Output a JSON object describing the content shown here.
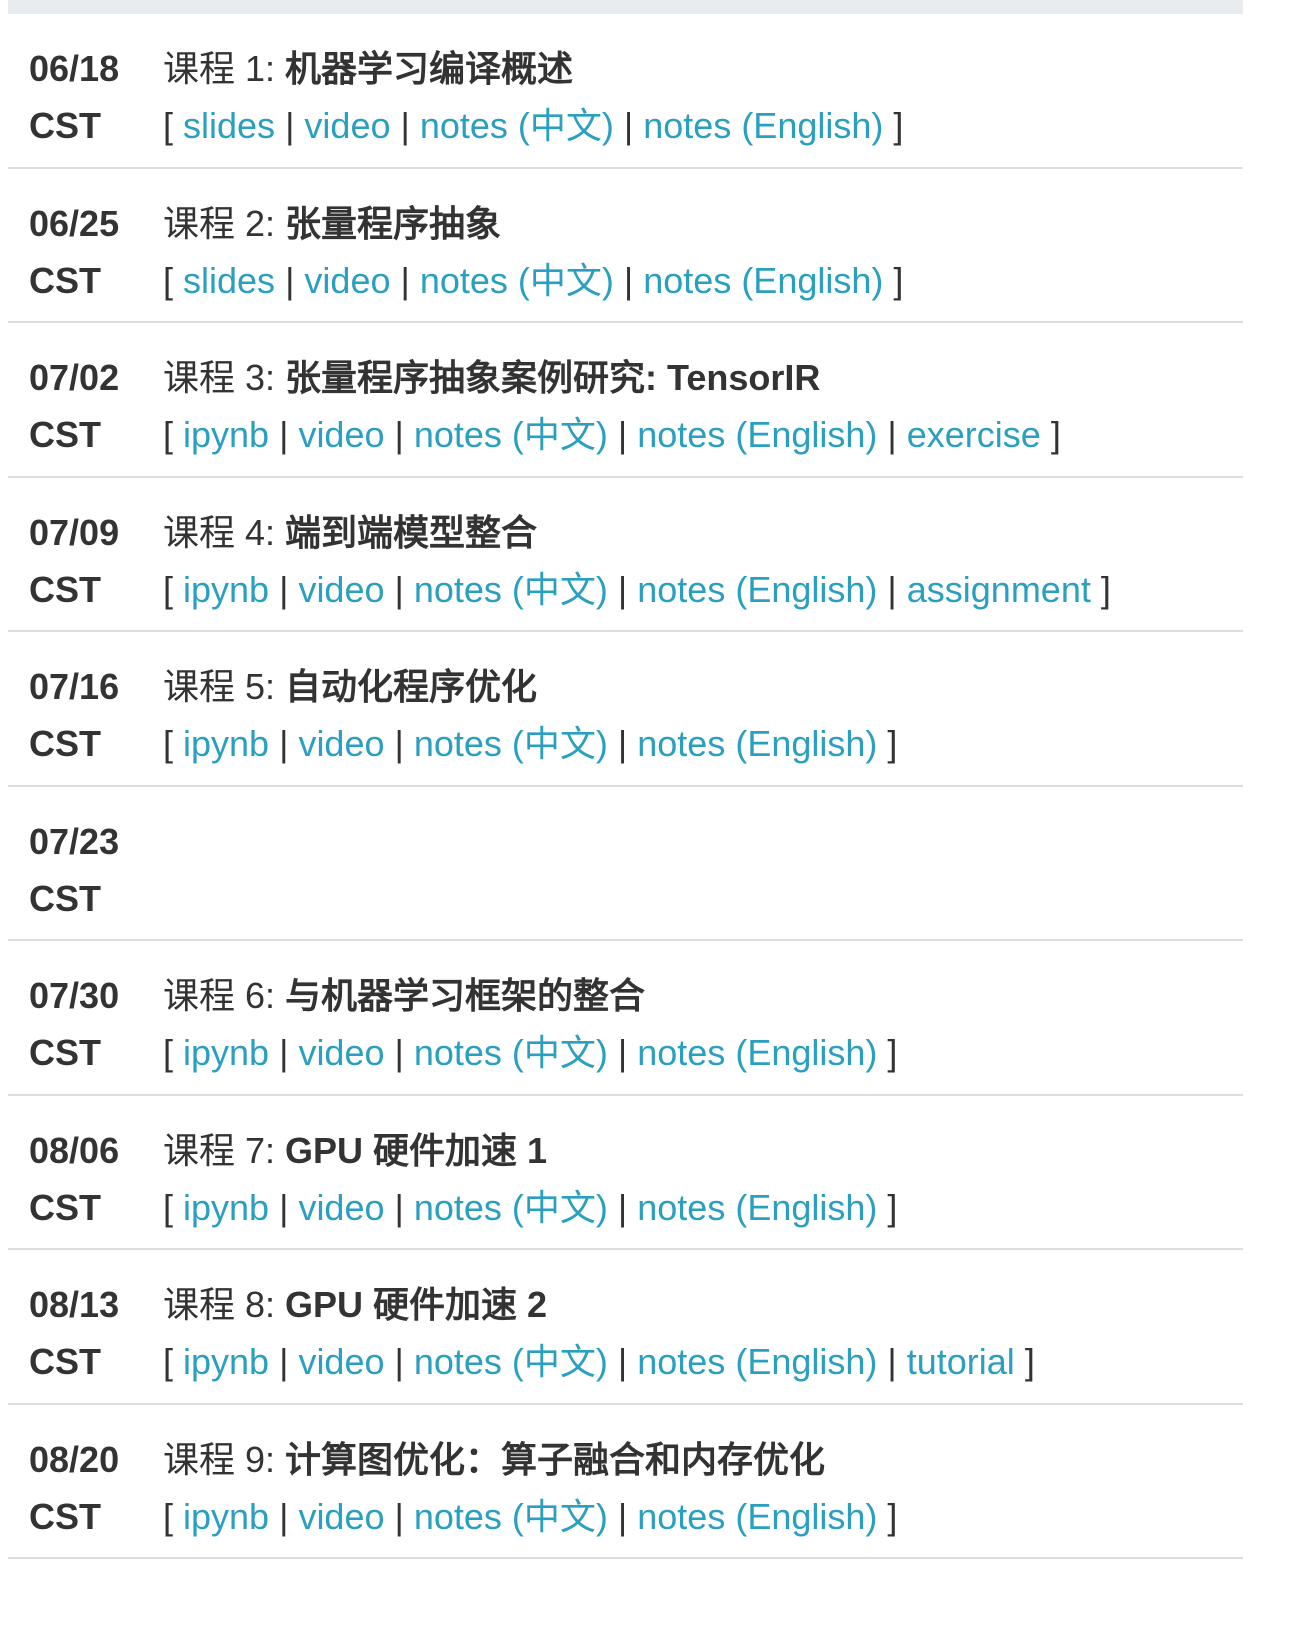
{
  "timezone": "CST",
  "colors": {
    "link": "#2a9fc0",
    "text": "#333333",
    "separator": "#dddddd",
    "top_band": "#e9ecef"
  },
  "rows": [
    {
      "date": "06/18",
      "prefix": "课程 1: ",
      "title": "机器学习编译概述",
      "links": [
        "slides",
        "video",
        "notes (中文)",
        "notes (English)"
      ]
    },
    {
      "date": "06/25",
      "prefix": "课程 2: ",
      "title": "张量程序抽象",
      "links": [
        "slides",
        "video",
        "notes (中文)",
        "notes (English)"
      ]
    },
    {
      "date": "07/02",
      "prefix": "课程 3: ",
      "title": "张量程序抽象案例研究: TensorIR",
      "links": [
        "ipynb",
        "video",
        "notes (中文)",
        "notes (English)",
        "exercise"
      ]
    },
    {
      "date": "07/09",
      "prefix": "课程 4: ",
      "title": "端到端模型整合",
      "links": [
        "ipynb",
        "video",
        "notes (中文)",
        "notes (English)",
        "assignment"
      ]
    },
    {
      "date": "07/16",
      "prefix": "课程 5: ",
      "title": "自动化程序优化",
      "links": [
        "ipynb",
        "video",
        "notes (中文)",
        "notes (English)"
      ]
    },
    {
      "date": "07/23",
      "prefix": "",
      "title": "",
      "links": []
    },
    {
      "date": "07/30",
      "prefix": "课程 6: ",
      "title": "与机器学习框架的整合",
      "links": [
        "ipynb",
        "video",
        "notes (中文)",
        "notes (English)"
      ]
    },
    {
      "date": "08/06",
      "prefix": "课程 7: ",
      "title": "GPU 硬件加速 1",
      "links": [
        "ipynb",
        "video",
        "notes (中文)",
        "notes (English)"
      ]
    },
    {
      "date": "08/13",
      "prefix": "课程 8: ",
      "title": "GPU 硬件加速 2",
      "links": [
        "ipynb",
        "video",
        "notes (中文)",
        "notes (English)",
        "tutorial"
      ]
    },
    {
      "date": "08/20",
      "prefix": "课程 9: ",
      "title": "计算图优化：算子融合和内存优化",
      "links": [
        "ipynb",
        "video",
        "notes (中文)",
        "notes (English)"
      ]
    }
  ]
}
